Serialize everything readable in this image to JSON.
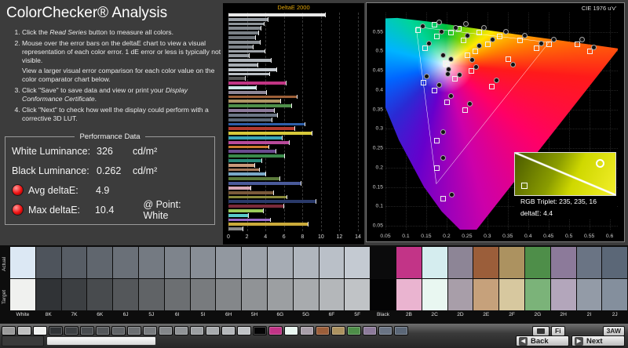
{
  "header": {
    "title": "ColorChecker® Analysis"
  },
  "instructions": {
    "item1_pre": "Click the ",
    "item1_em": "Read Series",
    "item1_post": " button to measure all colors.",
    "item2a": "Mouse over the error bars on the deltaE chart to view a visual representation of each color error. 1 dE error or less is typically not visible.",
    "item2b": "View a larger visual error comparison for each color value on the color comparator chart below.",
    "item3_pre": "Click \"Save\" to save data and view or print your ",
    "item3_em": "Display Conformance Certificate",
    "item3_post": ".",
    "item4": "Click \"Next\" to check how well the display could perform with a corrective 3D LUT."
  },
  "performance": {
    "title": "Performance Data",
    "white_luminance_label": "White Luminance:",
    "white_luminance_value": "326",
    "white_luminance_unit": "cd/m²",
    "black_luminance_label": "Black Luminance:",
    "black_luminance_value": "0.262",
    "black_luminance_unit": "cd/m²",
    "avg_deltae_label": "Avg deltaE:",
    "avg_deltae_value": "4.9",
    "max_deltae_label": "Max deltaE:",
    "max_deltae_value": "10.4",
    "max_point_label": "@ Point: White",
    "status_color": "#ee1111"
  },
  "cie": {
    "inset": {
      "rgb_label": "RGB Triplet: 235, 235, 16",
      "deltae_label": "deltaE: 4.4"
    }
  },
  "chart_data": [
    {
      "type": "bar",
      "orientation": "horizontal",
      "title": "DeltaE 2000",
      "xlabel": "",
      "ylabel": "",
      "xlim": [
        0,
        14
      ],
      "xticks": [
        0,
        2,
        4,
        6,
        8,
        10,
        12,
        14
      ],
      "grid": "dashed-vertical",
      "bars": {
        "values": [
          10.4,
          4.2,
          3.8,
          3.5,
          3.2,
          2.9,
          3.4,
          2.6,
          3.9,
          2.2,
          4.6,
          3.1,
          5.2,
          4.4,
          1.8,
          6.2,
          3.0,
          4.1,
          7.4,
          5.6,
          6.8,
          4.9,
          5.3,
          4.7,
          8.2,
          7.1,
          9.0,
          5.8,
          6.5,
          4.3,
          5.1,
          6.0,
          3.6,
          2.8,
          3.3,
          4.0,
          5.5,
          7.8,
          2.4,
          4.8,
          6.3,
          9.4,
          5.9,
          3.7,
          2.1,
          4.5,
          8.6,
          1.5
        ],
        "colors": [
          "#e8e8e8",
          "#9aa0a6",
          "#8f959b",
          "#848a90",
          "#7a8086",
          "#6f757b",
          "#8a8f95",
          "#7f848a",
          "#9fa4aa",
          "#94999f",
          "#b0b5bb",
          "#a5aab0",
          "#c5cad0",
          "#babfc5",
          "#555555",
          "#c13584",
          "#cfe8ea",
          "#8e8798",
          "#9c5f38",
          "#ad9464",
          "#4f8f4a",
          "#8d7b9b",
          "#6b7585",
          "#5c6878",
          "#2e5ea8",
          "#b33a2e",
          "#d8c93a",
          "#3aa6b8",
          "#b84a9a",
          "#cc7a2e",
          "#6a4a8e",
          "#3a8a4a",
          "#2a8a7a",
          "#c89a7a",
          "#a87a5a",
          "#7aa8c8",
          "#5a7a3a",
          "#4a5a9a",
          "#d8a8b8",
          "#7a5a3a",
          "#8a8a3a",
          "#2a3a6a",
          "#7a2a3a",
          "#9aca5a",
          "#5acaca",
          "#9a6aca",
          "#caaa3a",
          "#888888"
        ]
      }
    },
    {
      "type": "scatter",
      "title": "CIE 1976 u'v'",
      "xlim": [
        0.05,
        0.6
      ],
      "ylim": [
        0.05,
        0.6
      ],
      "xticks": [
        "0.05",
        "0.1",
        "0.15",
        "0.2",
        "0.25",
        "0.3",
        "0.35",
        "0.4",
        "0.45",
        "0.5",
        "0.55",
        "0.6"
      ],
      "yticks": [
        "0.55",
        "0.5",
        "0.45",
        "0.4",
        "0.35",
        "0.3",
        "0.25",
        "0.2",
        "0.15",
        "0.1",
        "0.05"
      ],
      "gamut_triangle": {
        "red": [
          0.451,
          0.523
        ],
        "green": [
          0.125,
          0.563
        ],
        "blue": [
          0.175,
          0.158
        ]
      },
      "series": [
        {
          "name": "Target",
          "marker": "square",
          "points": [
            [
              0.197,
              0.468
            ],
            [
              0.199,
              0.466
            ],
            [
              0.196,
              0.47
            ],
            [
              0.2,
              0.469
            ],
            [
              0.27,
              0.5
            ],
            [
              0.25,
              0.49
            ],
            [
              0.169,
              0.4
            ],
            [
              0.175,
              0.54
            ],
            [
              0.2,
              0.37
            ],
            [
              0.146,
              0.51
            ],
            [
              0.33,
              0.54
            ],
            [
              0.175,
              0.27
            ],
            [
              0.35,
              0.48
            ],
            [
              0.245,
              0.35
            ],
            [
              0.17,
              0.57
            ],
            [
              0.28,
              0.55
            ],
            [
              0.175,
              0.2
            ],
            [
              0.129,
              0.556
            ],
            [
              0.42,
              0.51
            ],
            [
              0.23,
              0.56
            ],
            [
              0.31,
              0.41
            ],
            [
              0.142,
              0.42
            ],
            [
              0.3,
              0.52
            ],
            [
              0.38,
              0.53
            ],
            [
              0.45,
              0.52
            ],
            [
              0.52,
              0.52
            ],
            [
              0.24,
              0.53
            ],
            [
              0.21,
              0.55
            ],
            [
              0.26,
              0.45
            ],
            [
              0.22,
              0.43
            ],
            [
              0.19,
              0.12
            ],
            [
              0.55,
              0.5
            ]
          ]
        },
        {
          "name": "Measured",
          "marker": "circle",
          "points": [
            [
              0.205,
              0.455
            ],
            [
              0.21,
              0.48
            ],
            [
              0.19,
              0.49
            ],
            [
              0.202,
              0.443
            ],
            [
              0.28,
              0.515
            ],
            [
              0.262,
              0.478
            ],
            [
              0.18,
              0.415
            ],
            [
              0.186,
              0.552
            ],
            [
              0.21,
              0.386
            ],
            [
              0.156,
              0.522
            ],
            [
              0.344,
              0.552
            ],
            [
              0.19,
              0.292
            ],
            [
              0.362,
              0.466
            ],
            [
              0.256,
              0.366
            ],
            [
              0.181,
              0.576
            ],
            [
              0.291,
              0.561
            ],
            [
              0.19,
              0.226
            ],
            [
              0.14,
              0.566
            ],
            [
              0.431,
              0.521
            ],
            [
              0.246,
              0.572
            ],
            [
              0.321,
              0.426
            ],
            [
              0.151,
              0.436
            ],
            [
              0.311,
              0.531
            ],
            [
              0.391,
              0.541
            ],
            [
              0.462,
              0.531
            ],
            [
              0.531,
              0.531
            ],
            [
              0.251,
              0.541
            ],
            [
              0.221,
              0.561
            ],
            [
              0.271,
              0.461
            ],
            [
              0.231,
              0.441
            ],
            [
              0.211,
              0.131
            ],
            [
              0.561,
              0.511
            ]
          ]
        }
      ]
    }
  ],
  "comparator": {
    "actual_label": "Actual",
    "target_label": "Target",
    "patches": [
      {
        "name": "White",
        "actual": "#dce8f4",
        "target": "#f0f1ef"
      },
      {
        "name": "8K",
        "actual": "#4e545c",
        "target": "#303336"
      },
      {
        "name": "7K",
        "actual": "#575d65",
        "target": "#3c3f42"
      },
      {
        "name": "6K",
        "actual": "#60666e",
        "target": "#484b4e"
      },
      {
        "name": "6J",
        "actual": "#6a7078",
        "target": "#54575a"
      },
      {
        "name": "5J",
        "actual": "#747a82",
        "target": "#606366"
      },
      {
        "name": "6I",
        "actual": "#7e848c",
        "target": "#6c6f72"
      },
      {
        "name": "5I",
        "actual": "#888e96",
        "target": "#787b7e"
      },
      {
        "name": "6H",
        "actual": "#9298a0",
        "target": "#84878a"
      },
      {
        "name": "5H",
        "actual": "#9ca2aa",
        "target": "#909396"
      },
      {
        "name": "6G",
        "actual": "#a6acb4",
        "target": "#9c9fa2"
      },
      {
        "name": "5G",
        "actual": "#b0b6be",
        "target": "#a8abae"
      },
      {
        "name": "6F",
        "actual": "#bac0c8",
        "target": "#b4b7ba"
      },
      {
        "name": "5F",
        "actual": "#c4cad2",
        "target": "#c0c3c6"
      },
      {
        "name": "Black",
        "actual": "#0b0b0c",
        "target": "#040405"
      },
      {
        "name": "2B",
        "actual": "#c23487",
        "target": "#eab4d0"
      },
      {
        "name": "2C",
        "actual": "#d5edef",
        "target": "#e9f7f1"
      },
      {
        "name": "2D",
        "actual": "#8d8596",
        "target": "#a89ea9"
      },
      {
        "name": "2E",
        "actual": "#9b5e3a",
        "target": "#c6a17b"
      },
      {
        "name": "2F",
        "actual": "#ac9260",
        "target": "#d7c89f"
      },
      {
        "name": "2G",
        "actual": "#4e8e49",
        "target": "#7bb379"
      },
      {
        "name": "2H",
        "actual": "#8c7a9a",
        "target": "#b3a6bb"
      },
      {
        "name": "2I",
        "actual": "#6a7484",
        "target": "#939ba7"
      },
      {
        "name": "2J",
        "actual": "#5b6777",
        "target": "#848f9d"
      }
    ]
  },
  "toolbar": {
    "palette": [
      "#9a9a9a",
      "#c0c0c0",
      "#f0f1ef",
      "#303336",
      "#3c3f42",
      "#484b4e",
      "#54575a",
      "#606366",
      "#6c6f72",
      "#787b7e",
      "#84878a",
      "#909396",
      "#9c9fa2",
      "#a8abae",
      "#b4b7ba",
      "#c0c3c6",
      "#040405",
      "#c23487",
      "#e9f7f1",
      "#a89ea9",
      "#9b5e3a",
      "#ac9260",
      "#4e8e49",
      "#8c7a9a",
      "#6a7484",
      "#5b6777"
    ],
    "fi_label": "Fi",
    "aw_label": "3AW",
    "back_label": "Back",
    "next_label": "Next",
    "back_icon": "◀",
    "next_icon": "▶"
  }
}
